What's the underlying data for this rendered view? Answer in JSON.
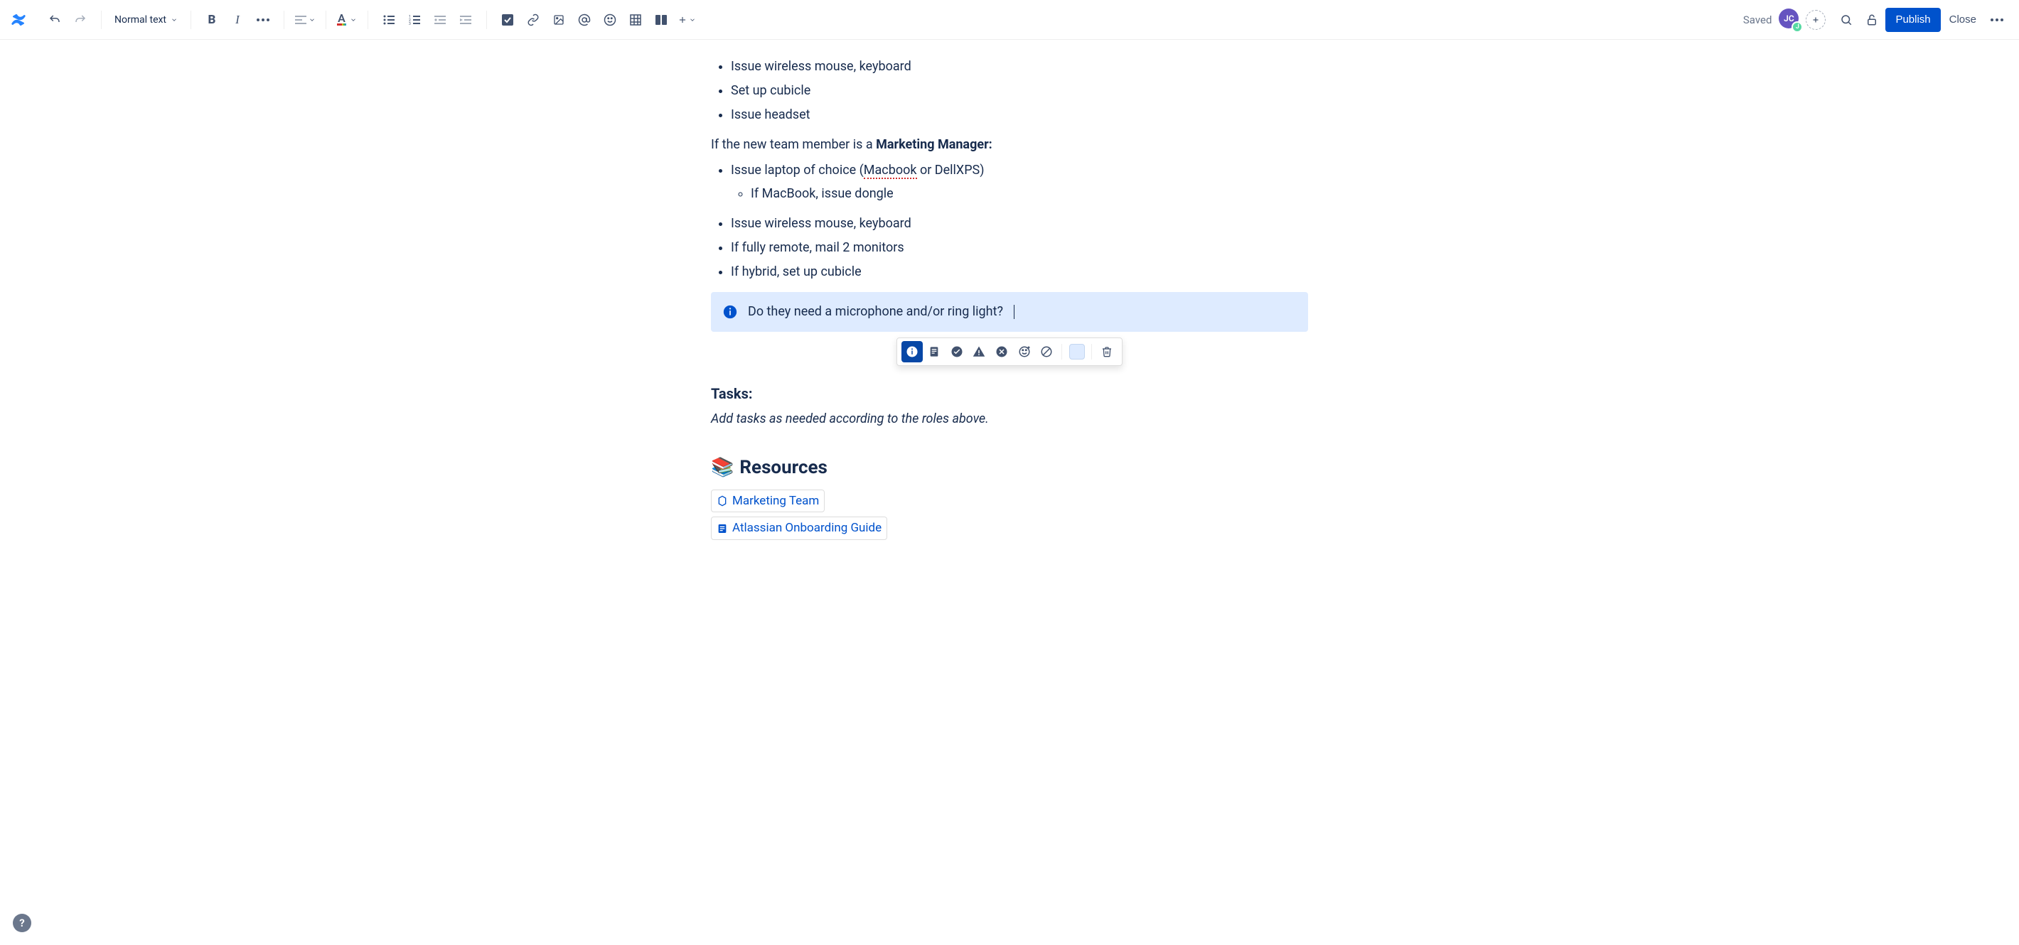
{
  "toolbar": {
    "text_style_label": "Normal text",
    "saved_label": "Saved",
    "avatar_initials": "JC",
    "avatar_mini": "J",
    "publish_label": "Publish",
    "close_label": "Close"
  },
  "content": {
    "list1": [
      "Issue wireless mouse, keyboard",
      "Set up cubicle",
      "Issue headset"
    ],
    "role_line_prefix": "If the new team member is a ",
    "role_line_bold": "Marketing Manager:",
    "list2_item1_pre": "Issue laptop of choice (",
    "list2_item1_spell": "Macbook",
    "list2_item1_post": " or DellXPS)",
    "list2_sub": "If MacBook, issue dongle",
    "list2_rest": [
      "Issue wireless mouse, keyboard",
      "If fully remote, mail 2 monitors",
      "If hybrid, set up cubicle"
    ],
    "panel_text": "Do they need a microphone and/or ring light?",
    "tasks_heading": "Tasks:",
    "tasks_sub": "Add tasks as needed according to the roles above.",
    "resources_heading": "Resources",
    "resources_emoji": "📚",
    "links": {
      "marketing": "Marketing Team",
      "onboarding": "Atlassian Onboarding Guide"
    }
  }
}
